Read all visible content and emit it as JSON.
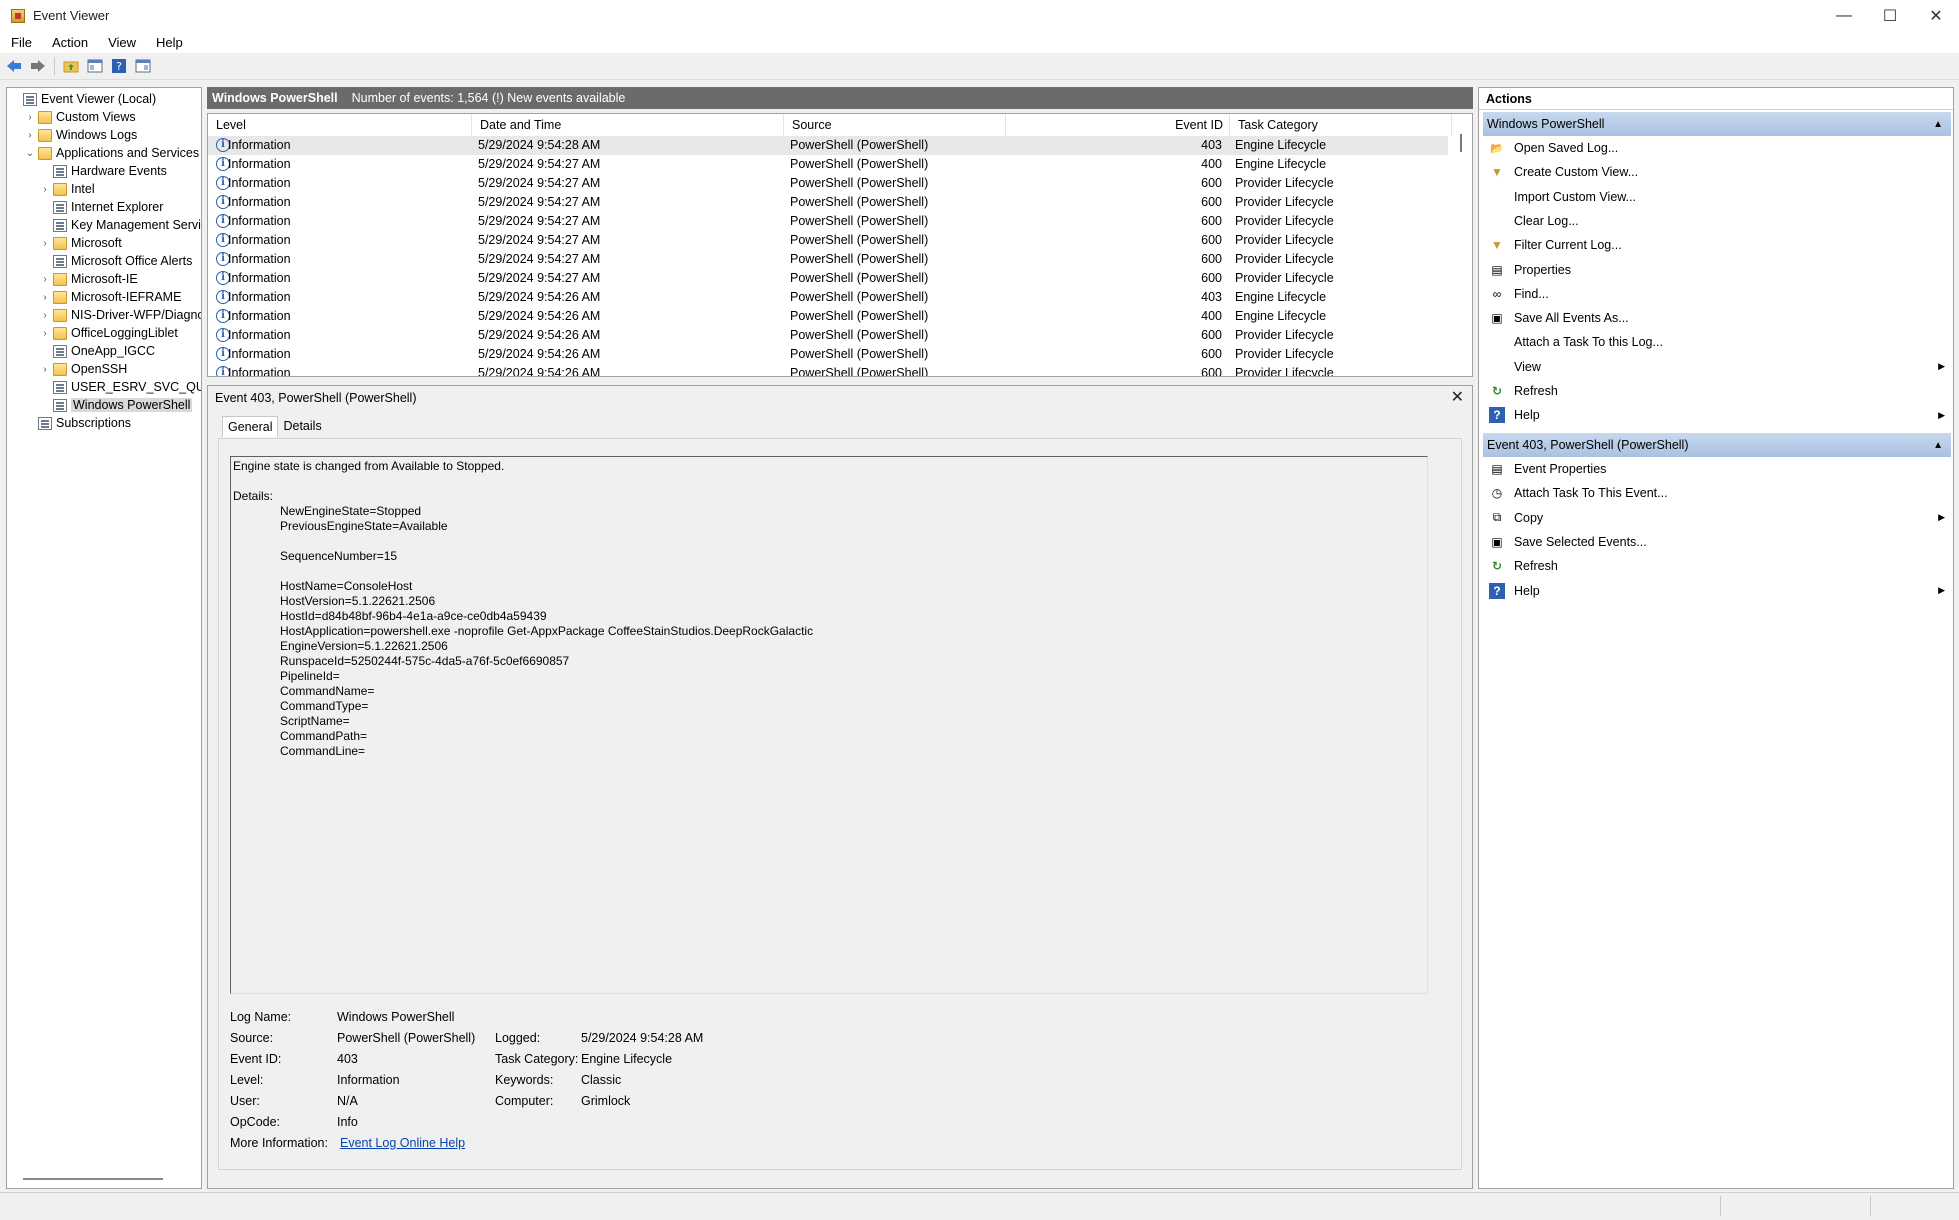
{
  "window": {
    "title": "Event Viewer",
    "minimize": "—",
    "maximize": "☐",
    "close": "✕"
  },
  "menu": [
    "File",
    "Action",
    "View",
    "Help"
  ],
  "tree": [
    {
      "label": "Event Viewer (Local)",
      "indent": 0,
      "expander": "",
      "icon": "event-viewer-icon"
    },
    {
      "label": "Custom Views",
      "indent": 1,
      "expander": "›",
      "icon": "folder-icon"
    },
    {
      "label": "Windows Logs",
      "indent": 1,
      "expander": "›",
      "icon": "folder-icon"
    },
    {
      "label": "Applications and Services Lo",
      "indent": 1,
      "expander": "⌄",
      "icon": "folder-icon"
    },
    {
      "label": "Hardware Events",
      "indent": 2,
      "expander": "",
      "icon": "log-icon"
    },
    {
      "label": "Intel",
      "indent": 2,
      "expander": "›",
      "icon": "folder-icon"
    },
    {
      "label": "Internet Explorer",
      "indent": 2,
      "expander": "",
      "icon": "log-icon"
    },
    {
      "label": "Key Management Service",
      "indent": 2,
      "expander": "",
      "icon": "log-icon"
    },
    {
      "label": "Microsoft",
      "indent": 2,
      "expander": "›",
      "icon": "folder-icon"
    },
    {
      "label": "Microsoft Office Alerts",
      "indent": 2,
      "expander": "",
      "icon": "log-icon"
    },
    {
      "label": "Microsoft-IE",
      "indent": 2,
      "expander": "›",
      "icon": "folder-icon"
    },
    {
      "label": "Microsoft-IEFRAME",
      "indent": 2,
      "expander": "›",
      "icon": "folder-icon"
    },
    {
      "label": "NIS-Driver-WFP/Diagnos",
      "indent": 2,
      "expander": "›",
      "icon": "folder-icon"
    },
    {
      "label": "OfficeLoggingLiblet",
      "indent": 2,
      "expander": "›",
      "icon": "folder-icon"
    },
    {
      "label": "OneApp_IGCC",
      "indent": 2,
      "expander": "",
      "icon": "log-icon"
    },
    {
      "label": "OpenSSH",
      "indent": 2,
      "expander": "›",
      "icon": "folder-icon"
    },
    {
      "label": "USER_ESRV_SVC_QUEENC",
      "indent": 2,
      "expander": "",
      "icon": "log-icon"
    },
    {
      "label": "Windows PowerShell",
      "indent": 2,
      "expander": "",
      "icon": "log-icon",
      "selected": true
    },
    {
      "label": "Subscriptions",
      "indent": 1,
      "expander": "",
      "icon": "log-icon"
    }
  ],
  "log_header": {
    "title": "Windows PowerShell",
    "summary": "Number of events: 1,564 (!) New events available"
  },
  "columns": [
    "Level",
    "Date and Time",
    "Source",
    "Event ID",
    "Task Category"
  ],
  "events": [
    {
      "level": "Information",
      "date": "5/29/2024 9:54:28 AM",
      "source": "PowerShell (PowerShell)",
      "id": "403",
      "task": "Engine Lifecycle"
    },
    {
      "level": "Information",
      "date": "5/29/2024 9:54:27 AM",
      "source": "PowerShell (PowerShell)",
      "id": "400",
      "task": "Engine Lifecycle"
    },
    {
      "level": "Information",
      "date": "5/29/2024 9:54:27 AM",
      "source": "PowerShell (PowerShell)",
      "id": "600",
      "task": "Provider Lifecycle"
    },
    {
      "level": "Information",
      "date": "5/29/2024 9:54:27 AM",
      "source": "PowerShell (PowerShell)",
      "id": "600",
      "task": "Provider Lifecycle"
    },
    {
      "level": "Information",
      "date": "5/29/2024 9:54:27 AM",
      "source": "PowerShell (PowerShell)",
      "id": "600",
      "task": "Provider Lifecycle"
    },
    {
      "level": "Information",
      "date": "5/29/2024 9:54:27 AM",
      "source": "PowerShell (PowerShell)",
      "id": "600",
      "task": "Provider Lifecycle"
    },
    {
      "level": "Information",
      "date": "5/29/2024 9:54:27 AM",
      "source": "PowerShell (PowerShell)",
      "id": "600",
      "task": "Provider Lifecycle"
    },
    {
      "level": "Information",
      "date": "5/29/2024 9:54:27 AM",
      "source": "PowerShell (PowerShell)",
      "id": "600",
      "task": "Provider Lifecycle"
    },
    {
      "level": "Information",
      "date": "5/29/2024 9:54:26 AM",
      "source": "PowerShell (PowerShell)",
      "id": "403",
      "task": "Engine Lifecycle"
    },
    {
      "level": "Information",
      "date": "5/29/2024 9:54:26 AM",
      "source": "PowerShell (PowerShell)",
      "id": "400",
      "task": "Engine Lifecycle"
    },
    {
      "level": "Information",
      "date": "5/29/2024 9:54:26 AM",
      "source": "PowerShell (PowerShell)",
      "id": "600",
      "task": "Provider Lifecycle"
    },
    {
      "level": "Information",
      "date": "5/29/2024 9:54:26 AM",
      "source": "PowerShell (PowerShell)",
      "id": "600",
      "task": "Provider Lifecycle"
    },
    {
      "level": "Information",
      "date": "5/29/2024 9:54:26 AM",
      "source": "PowerShell (PowerShell)",
      "id": "600",
      "task": "Provider Lifecycle"
    }
  ],
  "detail": {
    "title": "Event 403, PowerShell (PowerShell)",
    "close": "✕",
    "tabs": [
      "General",
      "Details"
    ],
    "message_lines": [
      {
        "text": "Engine state is changed from Available to Stopped.",
        "indent": false
      },
      {
        "text": "",
        "indent": false
      },
      {
        "text": "Details:",
        "indent": false
      },
      {
        "text": "NewEngineState=Stopped",
        "indent": true
      },
      {
        "text": "PreviousEngineState=Available",
        "indent": true
      },
      {
        "text": "",
        "indent": true
      },
      {
        "text": "SequenceNumber=15",
        "indent": true
      },
      {
        "text": "",
        "indent": true
      },
      {
        "text": "HostName=ConsoleHost",
        "indent": true
      },
      {
        "text": "HostVersion=5.1.22621.2506",
        "indent": true
      },
      {
        "text": "HostId=d84b48bf-96b4-4e1a-a9ce-ce0db4a59439",
        "indent": true
      },
      {
        "text": "HostApplication=powershell.exe -noprofile Get-AppxPackage CoffeeStainStudios.DeepRockGalactic",
        "indent": true
      },
      {
        "text": "EngineVersion=5.1.22621.2506",
        "indent": true
      },
      {
        "text": "RunspaceId=5250244f-575c-4da5-a76f-5c0ef6690857",
        "indent": true
      },
      {
        "text": "PipelineId=",
        "indent": true
      },
      {
        "text": "CommandName=",
        "indent": true
      },
      {
        "text": "CommandType=",
        "indent": true
      },
      {
        "text": "ScriptName=",
        "indent": true
      },
      {
        "text": "CommandPath=",
        "indent": true
      },
      {
        "text": "CommandLine=",
        "indent": true
      }
    ],
    "props": {
      "log_name_label": "Log Name:",
      "log_name": "Windows PowerShell",
      "source_label": "Source:",
      "source": "PowerShell (PowerShell)",
      "logged_label": "Logged:",
      "logged": "5/29/2024 9:54:28 AM",
      "event_id_label": "Event ID:",
      "event_id": "403",
      "task_category_label": "Task Category:",
      "task_category": "Engine Lifecycle",
      "level_label": "Level:",
      "level": "Information",
      "keywords_label": "Keywords:",
      "keywords": "Classic",
      "user_label": "User:",
      "user": "N/A",
      "computer_label": "Computer:",
      "computer": "Grimlock",
      "opcode_label": "OpCode:",
      "opcode": "Info",
      "more_info_label": "More Information:",
      "more_info_link": "Event Log Online Help"
    }
  },
  "actions": {
    "header": "Actions",
    "section1": "Windows PowerShell",
    "items1": [
      {
        "label": "Open Saved Log...",
        "icon": "open-folder-icon",
        "glyph": "📂",
        "submenu": false
      },
      {
        "label": "Create Custom View...",
        "icon": "filter-icon",
        "glyph": "▼",
        "submenu": false
      },
      {
        "label": "Import Custom View...",
        "icon": "",
        "glyph": "",
        "submenu": false
      },
      {
        "label": "Clear Log...",
        "icon": "",
        "glyph": "",
        "submenu": false
      },
      {
        "label": "Filter Current Log...",
        "icon": "filter-icon",
        "glyph": "▼",
        "submenu": false
      },
      {
        "label": "Properties",
        "icon": "properties-icon",
        "glyph": "▤",
        "submenu": false
      },
      {
        "label": "Find...",
        "icon": "binoculars-icon",
        "glyph": "∞",
        "submenu": false
      },
      {
        "label": "Save All Events As...",
        "icon": "save-icon",
        "glyph": "▣",
        "submenu": false
      },
      {
        "label": "Attach a Task To this Log...",
        "icon": "",
        "glyph": "",
        "submenu": false
      },
      {
        "label": "View",
        "icon": "",
        "glyph": "",
        "submenu": true
      },
      {
        "label": "Refresh",
        "icon": "refresh-icon",
        "glyph": "↻",
        "submenu": false
      },
      {
        "label": "Help",
        "icon": "help-icon",
        "glyph": "?",
        "submenu": true
      }
    ],
    "section2": "Event 403, PowerShell (PowerShell)",
    "items2": [
      {
        "label": "Event Properties",
        "icon": "properties-icon",
        "glyph": "▤",
        "submenu": false
      },
      {
        "label": "Attach Task To This Event...",
        "icon": "task-icon",
        "glyph": "◷",
        "submenu": false
      },
      {
        "label": "Copy",
        "icon": "copy-icon",
        "glyph": "⧉",
        "submenu": true
      },
      {
        "label": "Save Selected Events...",
        "icon": "save-icon",
        "glyph": "▣",
        "submenu": false
      },
      {
        "label": "Refresh",
        "icon": "refresh-icon",
        "glyph": "↻",
        "submenu": false
      },
      {
        "label": "Help",
        "icon": "help-icon",
        "glyph": "?",
        "submenu": true
      }
    ],
    "arrow": "▶",
    "collapse": "▲"
  },
  "colors": {
    "section_bg": "#b3c8e6",
    "header_bg": "#6b6b6b",
    "link": "#0645ad",
    "info_icon": "#2a5fa8"
  }
}
